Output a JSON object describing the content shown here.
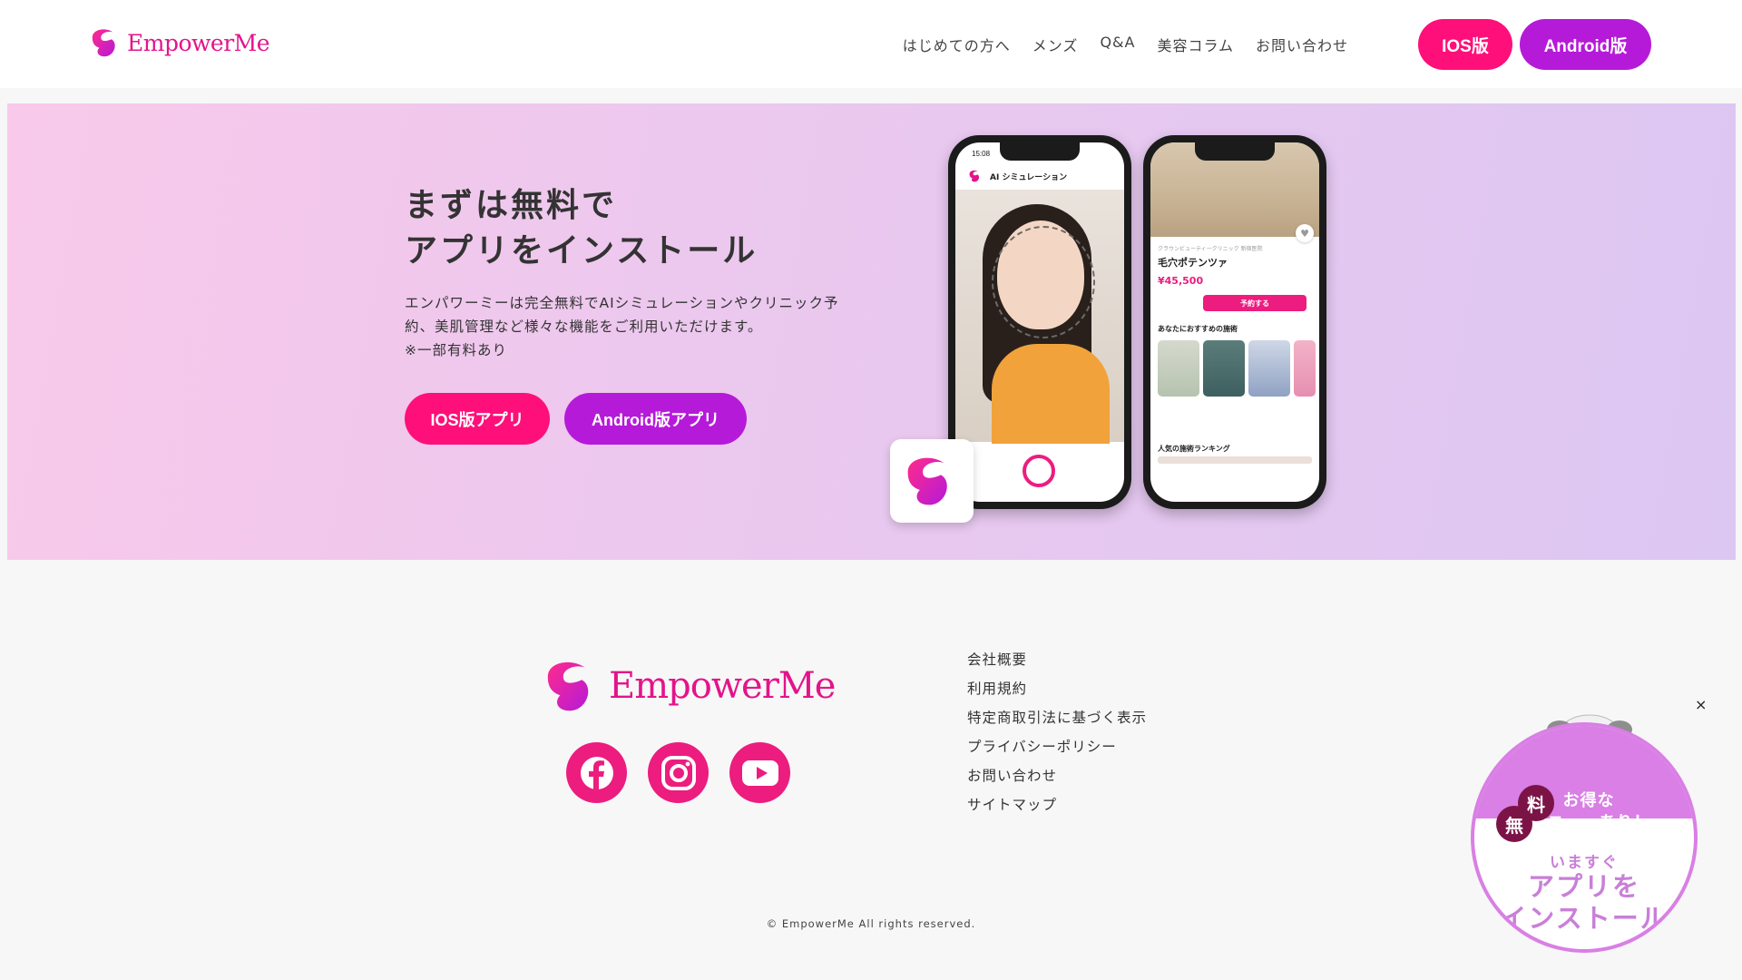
{
  "header": {
    "brand": "EmpowerMe",
    "nav": [
      "はじめての方へ",
      "メンズ",
      "Q&A",
      "美容コラム",
      "お問い合わせ"
    ],
    "ios_button": "IOS版",
    "android_button": "Android版"
  },
  "hero": {
    "title_line1": "まずは無料で",
    "title_line2": "アプリをインストール",
    "desc_line1": "エンパワーミーは完全無料でAIシミュレーションやクリニック予",
    "desc_line2": "約、美肌管理など様々な機能をご利用いただけます。",
    "desc_line3": "※一部有料あり",
    "ios_button": "IOS版アプリ",
    "android_button": "Android版アプリ"
  },
  "phone1": {
    "time": "15:08",
    "title": "AI シミュレーション"
  },
  "phone2": {
    "clinic": "クラウンビューティークリニック 新宿医院",
    "treatment": "毛穴ポテンツァ",
    "price": "¥45,500",
    "reserve": "予約する",
    "recommend_heading": "あなたにおすすめの施術",
    "ranking_heading": "人気の施術ランキング"
  },
  "footer": {
    "brand": "EmpowerMe",
    "links": [
      "会社概要",
      "利用規約",
      "特定商取引法に基づく表示",
      "プライバシーポリシー",
      "お問い合わせ",
      "サイトマップ"
    ],
    "copyright": "© EmpowerMe All rights reserved."
  },
  "badge": {
    "close": "×",
    "stamp_a": "料",
    "stamp_b": "無",
    "line1": "お得な",
    "line2": "メニューあり！",
    "sub": "いますぐ",
    "big1": "アプリを",
    "big2": "インストール"
  },
  "colors": {
    "pink": "#ff0f7a",
    "purple": "#b61ad9",
    "brand": "#e4138a",
    "badge": "#d97fe5"
  },
  "icons": [
    "empowerme-logo-icon",
    "facebook-icon",
    "instagram-icon",
    "youtube-icon",
    "close-icon"
  ]
}
